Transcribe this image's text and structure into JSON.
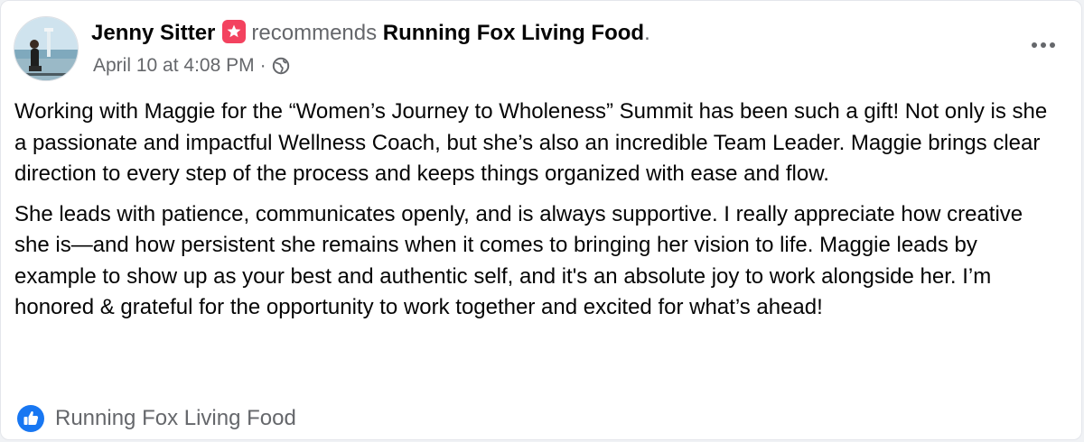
{
  "post": {
    "author_name": "Jenny Sitter",
    "recommends_text": "recommends",
    "page_name": "Running Fox Living Food",
    "period": ".",
    "timestamp": "April 10 at 4:08 PM",
    "separator": "·",
    "privacy_icon": "globe-icon",
    "more_icon": "more-options-icon",
    "paragraphs": [
      "Working with Maggie for the “Women’s Journey to Wholeness” Summit has been such a gift! Not only is she a passionate and impactful Wellness Coach, but she’s also an incredible Team Leader. Maggie brings clear direction to every step of the process and keeps things organized with ease and flow.",
      "She leads with patience, communicates openly, and is always supportive. I really appreciate how creative she is—and how persistent she remains when it comes to bringing her vision to life. Maggie leads by example to show up as your best and authentic self, and it's an absolute joy to work alongside her. I’m honored & grateful for the opportunity to work together and excited for what’s ahead!"
    ],
    "footer_page": "Running Fox Living Food",
    "footer_icon": "like-icon"
  },
  "colors": {
    "badge": "#f3425f",
    "like_blue": "#1877f2",
    "secondary_text": "#65676b"
  }
}
